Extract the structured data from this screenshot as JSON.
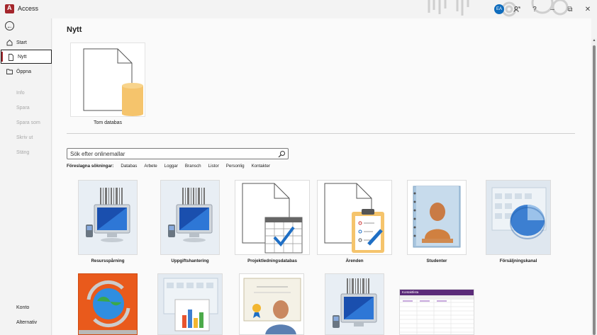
{
  "app": {
    "title": "Access",
    "user_initials": "EA"
  },
  "window_controls": {
    "help": "?",
    "minimize": "–",
    "restore": "⧉",
    "close": "✕"
  },
  "sidebar": {
    "items": [
      {
        "label": "Start",
        "icon": "home-icon",
        "state": "normal"
      },
      {
        "label": "Nytt",
        "icon": "new-document-icon",
        "state": "active"
      },
      {
        "label": "Öppna",
        "icon": "folder-icon",
        "state": "normal"
      },
      {
        "label": "Info",
        "state": "disabled"
      },
      {
        "label": "Spara",
        "state": "disabled"
      },
      {
        "label": "Spara som",
        "state": "disabled"
      },
      {
        "label": "Skriv ut",
        "state": "disabled"
      },
      {
        "label": "Stäng",
        "state": "disabled"
      }
    ],
    "bottom": [
      {
        "label": "Konto"
      },
      {
        "label": "Alternativ"
      }
    ]
  },
  "main": {
    "title": "Nytt",
    "blank_template": {
      "label": "Tom databas"
    },
    "search": {
      "placeholder": "Sök efter onlinemallar"
    },
    "suggested": {
      "label": "Föreslagna sökningar:",
      "links": [
        "Databas",
        "Arbete",
        "Loggar",
        "Bransch",
        "Listor",
        "Personlig",
        "Kontakter"
      ]
    },
    "templates_row1": [
      {
        "label": "Resursspårning",
        "thumb": "computer-barcode"
      },
      {
        "label": "Uppgiftshantering",
        "thumb": "computer-barcode"
      },
      {
        "label": "Projektledningsdatabas",
        "thumb": "doc-calendar-check"
      },
      {
        "label": "Ärenden",
        "thumb": "doc-clipboard"
      },
      {
        "label": "Studenter",
        "thumb": "notebook-person"
      },
      {
        "label": "Försäljningskanal",
        "thumb": "calendar-pie"
      }
    ],
    "templates_row2": [
      {
        "thumb": "orange-globe-arrows"
      },
      {
        "thumb": "calendar-presentation"
      },
      {
        "thumb": "certificate-person"
      },
      {
        "thumb": "computer-barcode"
      },
      {
        "thumb": "contact-list-sheet",
        "sheet_title": "Kontaktlista"
      }
    ]
  },
  "colors": {
    "accent": "#a4262c",
    "avatar": "#0f6cbd",
    "db_yellow": "#f5c46c",
    "check_blue": "#1f6fc5"
  }
}
